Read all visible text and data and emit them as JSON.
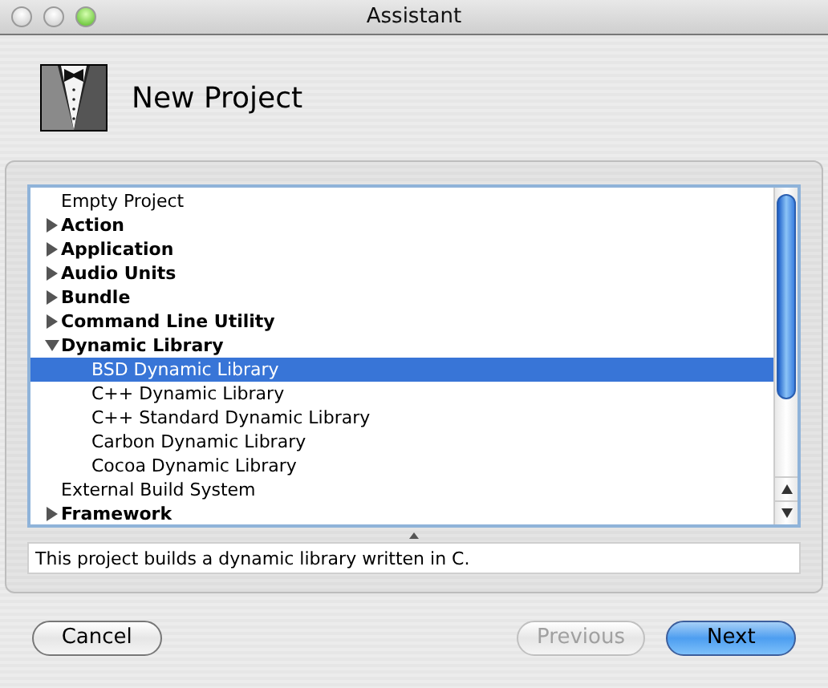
{
  "window": {
    "title": "Assistant"
  },
  "header": {
    "title": "New Project"
  },
  "tree": [
    {
      "kind": "leaf",
      "label": "Empty Project",
      "selected": false
    },
    {
      "kind": "group",
      "label": "Action",
      "expanded": false,
      "selected": false
    },
    {
      "kind": "group",
      "label": "Application",
      "expanded": false,
      "selected": false
    },
    {
      "kind": "group",
      "label": "Audio Units",
      "expanded": false,
      "selected": false
    },
    {
      "kind": "group",
      "label": "Bundle",
      "expanded": false,
      "selected": false
    },
    {
      "kind": "group",
      "label": "Command Line Utility",
      "expanded": false,
      "selected": false
    },
    {
      "kind": "group",
      "label": "Dynamic Library",
      "expanded": true,
      "selected": false,
      "children": [
        {
          "kind": "leaf",
          "label": "BSD Dynamic Library",
          "selected": true
        },
        {
          "kind": "leaf",
          "label": "C++ Dynamic Library",
          "selected": false
        },
        {
          "kind": "leaf",
          "label": "C++ Standard Dynamic Library",
          "selected": false
        },
        {
          "kind": "leaf",
          "label": "Carbon Dynamic Library",
          "selected": false
        },
        {
          "kind": "leaf",
          "label": "Cocoa Dynamic Library",
          "selected": false
        }
      ]
    },
    {
      "kind": "leaf",
      "label": "External Build System",
      "selected": false
    },
    {
      "kind": "group",
      "label": "Framework",
      "expanded": false,
      "selected": false
    }
  ],
  "description": "This project builds a dynamic library written in C.",
  "buttons": [
    {
      "kind": "cancel",
      "label": "Cancel",
      "disabled": false,
      "default": false
    },
    {
      "kind": "previous",
      "label": "Previous",
      "disabled": true,
      "default": false
    },
    {
      "kind": "next",
      "label": "Next",
      "disabled": false,
      "default": true
    }
  ]
}
